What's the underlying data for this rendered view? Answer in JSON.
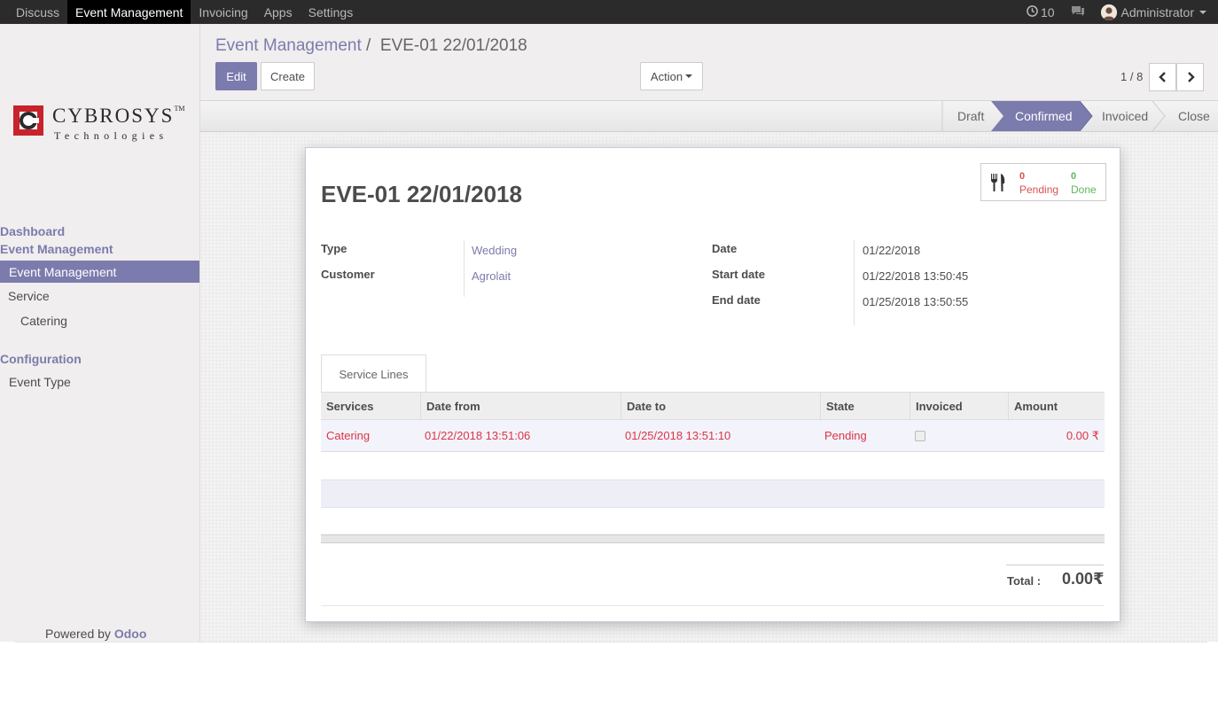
{
  "topbar": {
    "menu": [
      "Discuss",
      "Event Management",
      "Invoicing",
      "Apps",
      "Settings"
    ],
    "active_menu": "Event Management",
    "notifications_count": "10",
    "user": "Administrator"
  },
  "sidebar": {
    "logo_name": "CYBROSYS",
    "logo_tm": "TM",
    "logo_sub": "Technologies",
    "sections": {
      "dashboard": "Dashboard",
      "event_management": "Event Management",
      "configuration": "Configuration"
    },
    "items": {
      "event_management": "Event Management",
      "service": "Service",
      "catering": "Catering",
      "event_type": "Event Type"
    },
    "powered_prefix": "Powered by",
    "powered_brand": "Odoo"
  },
  "control": {
    "breadcrumb_parent": "Event Management",
    "breadcrumb_sep": "/",
    "breadcrumb_current": "EVE-01 22/01/2018",
    "edit_label": "Edit",
    "create_label": "Create",
    "action_label": "Action",
    "pager": "1 / 8"
  },
  "status": {
    "stages": [
      "Draft",
      "Confirmed",
      "Invoiced",
      "Close"
    ],
    "active_stage": "Confirmed"
  },
  "form": {
    "title": "EVE-01 22/01/2018",
    "smart_button": {
      "pending_count": "0",
      "pending_label": "Pending",
      "done_count": "0",
      "done_label": "Done"
    },
    "fields": {
      "type_label": "Type",
      "type_value": "Wedding",
      "customer_label": "Customer",
      "customer_value": "Agrolait",
      "date_label": "Date",
      "date_value": "01/22/2018",
      "start_label": "Start date",
      "start_value": "01/22/2018 13:50:45",
      "end_label": "End date",
      "end_value": "01/25/2018 13:50:55"
    },
    "tab_label": "Service Lines",
    "table": {
      "headers": [
        "Services",
        "Date from",
        "Date to",
        "State",
        "Invoiced",
        "Amount"
      ],
      "rows": [
        {
          "service": "Catering",
          "date_from": "01/22/2018 13:51:06",
          "date_to": "01/25/2018 13:51:10",
          "state": "Pending",
          "invoiced": false,
          "amount": "0.00 ₹"
        }
      ]
    },
    "total_label": "Total :",
    "total_value": "0.00₹"
  },
  "colors": {
    "brand": "#7c7bad",
    "danger": "#dc3545",
    "success": "#5cb85c"
  }
}
